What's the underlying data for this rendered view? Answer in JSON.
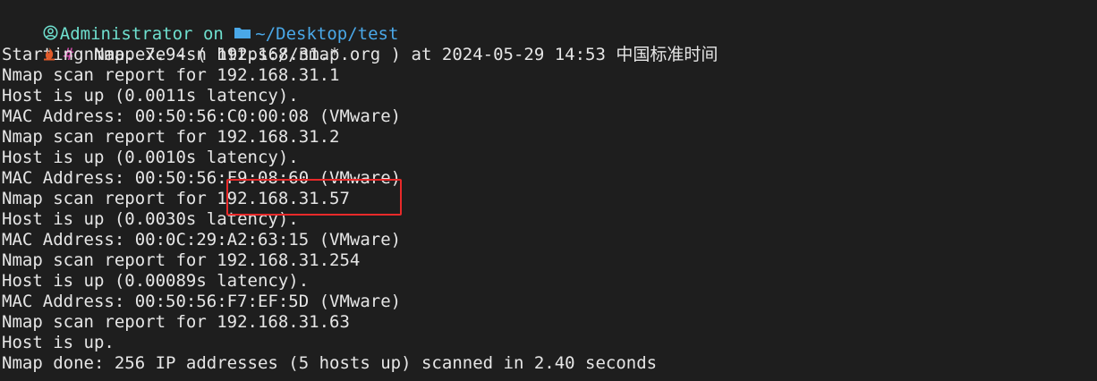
{
  "prompt": {
    "user": "Administrator",
    "on": "on",
    "path": "~/Desktop/test",
    "symbol": "#",
    "command": "nmap.exe -sn 192.168.31.*",
    "colors": {
      "user": "#6fe0cf",
      "path": "#4aa8e8",
      "hash": "#d94fb2",
      "text": "#e6e6e6",
      "highlight": "#e82a2a"
    },
    "icons": {
      "user_icon": "person-circle-icon",
      "folder_icon": "folder-icon",
      "shell_icon": "flame-icon"
    }
  },
  "output": [
    "Starting Nmap 7.94 ( https://nmap.org ) at 2024-05-29 14:53 中国标准时间",
    "Nmap scan report for 192.168.31.1",
    "Host is up (0.0011s latency).",
    "MAC Address: 00:50:56:C0:00:08 (VMware)",
    "Nmap scan report for 192.168.31.2",
    "Host is up (0.0010s latency).",
    "MAC Address: 00:50:56:F9:08:60 (VMware)",
    "Nmap scan report for 192.168.31.57",
    "Host is up (0.0030s latency).",
    "MAC Address: 00:0C:29:A2:63:15 (VMware)",
    "Nmap scan report for 192.168.31.254",
    "Host is up (0.00089s latency).",
    "MAC Address: 00:50:56:F7:EF:5D (VMware)",
    "Nmap scan report for 192.168.31.63",
    "Host is up.",
    "Nmap done: 256 IP addresses (5 hosts up) scanned in 2.40 seconds"
  ],
  "highlight": {
    "text": "192.168.31.57",
    "line_index": 7
  }
}
